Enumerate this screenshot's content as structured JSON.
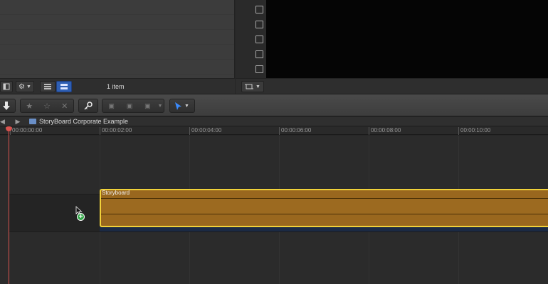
{
  "browser": {
    "item_count": "1 item"
  },
  "toolbar": {
    "import_icon": "down-arrow-icon",
    "rating_icons": [
      "★",
      "☆",
      "✕"
    ],
    "edit_icons": [
      "▣",
      "▣",
      "▣"
    ],
    "edit_sublabels": [
      "",
      "+++",
      ""
    ],
    "select_icon": "pointer-icon"
  },
  "timeline": {
    "nav_back": "◀",
    "nav_forward": "▶",
    "project_title": "StoryBoard Corporate Example",
    "clip_title": "Storyboard",
    "ruler": [
      {
        "label": "00:00:00:00"
      },
      {
        "label": "00:00:02:00"
      },
      {
        "label": "00:00:04:00"
      },
      {
        "label": "00:00:06:00"
      },
      {
        "label": "00:00:08:00"
      },
      {
        "label": "00:00:10:00"
      }
    ]
  },
  "colors": {
    "accent": "#2f5fb3",
    "clip": "#99671e",
    "clip_selected_border": "#f1d23a",
    "playhead": "#d9534f",
    "add_badge": "#35a84b"
  }
}
